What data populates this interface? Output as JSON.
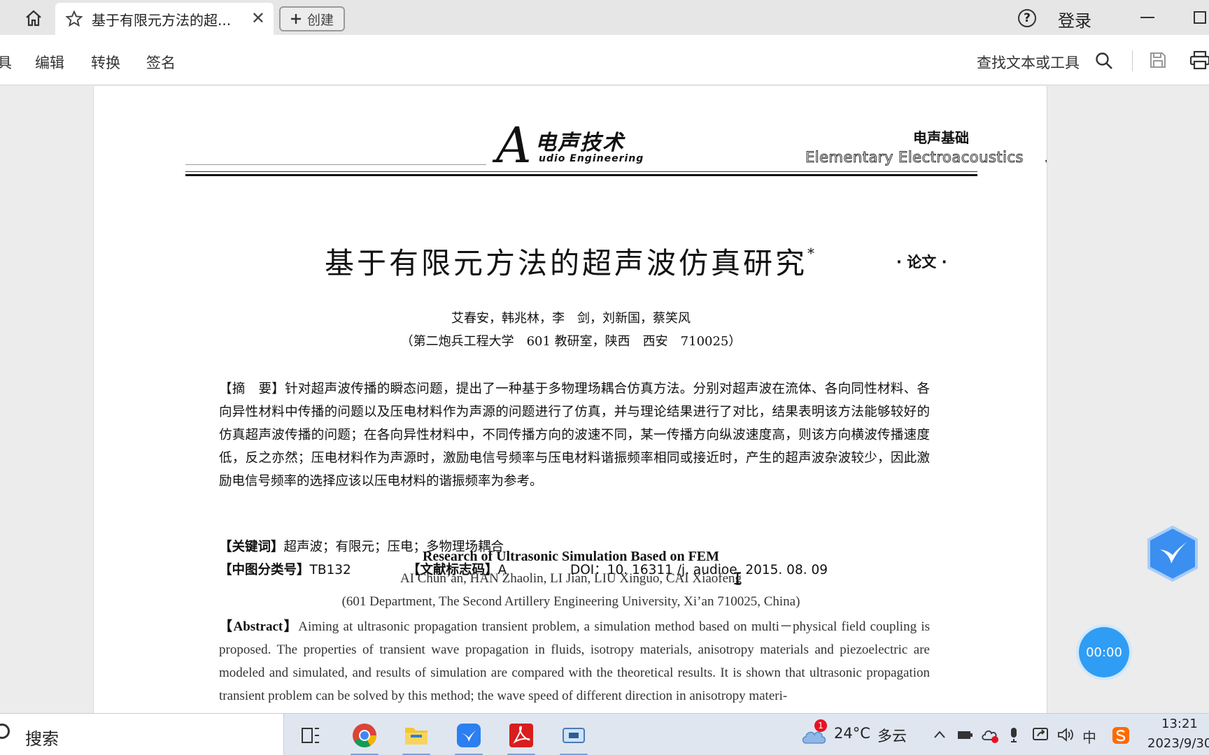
{
  "tabbar": {
    "tab_title": "基于有限元方法的超...",
    "close_glyph": "✕",
    "create_label": "创建",
    "help_glyph": "?",
    "login_label": "登录"
  },
  "toolbar": {
    "menu": [
      "具",
      "编辑",
      "转换",
      "签名"
    ],
    "find_label": "查找文本或工具"
  },
  "document": {
    "journal_logo_letter": "A",
    "journal_name_cn": "电声技术",
    "journal_name_en": "udio Engineering",
    "section_cn": "电声基础",
    "section_en": "Elementary Electroacoustics",
    "title_cn": "基于有限元方法的超声波仿真研究",
    "title_mark": "*",
    "paper_type": "· 论文 ·",
    "authors_cn": "艾春安，韩兆林，李　剑，刘新国，蔡笑风",
    "affiliation_cn": "（第二炮兵工程大学　601 教研室，陕西　西安　710025）",
    "abstract_cn": "【摘　要】针对超声波传播的瞬态问题，提出了一种基于多物理场耦合仿真方法。分别对超声波在流体、各向同性材料、各向异性材料中传播的问题以及压电材料作为声源的问题进行了仿真，并与理论结果进行了对比，结果表明该方法能够较好的仿真超声波传播的问题；在各向异性材料中，不同传播方向的波速不同，某一传播方向纵波速度高，则该方向横波传播速度低，反之亦然；压电材料作为声源时，激励电信号频率与压电材料谐振频率相同或接近时，产生的超声波杂波较少，因此激励电信号频率的选择应该以压电材料的谐振频率为参考。",
    "keywords_label": "【关键词】",
    "keywords": "超声波；有限元；压电；多物理场耦合",
    "clc_label": "【中图分类号】",
    "clc": "TB132",
    "doc_code_label": "【文献标志码】",
    "doc_code": "A",
    "doi": "DOI：10. 16311 /j. audioe. 2015. 08. 09",
    "title_en": "Research of Ultrasonic Simulation Based on FEM",
    "authors_en": "AI Chun’an, HAN Zhaolin, LI Jian, LIU Xinguo, CAI Xiaofeng",
    "affiliation_en": "(601 Department, The Second Artillery Engineering University, Xi’an 710025, China)",
    "abstract_en_label": "【Abstract】",
    "abstract_en": "Aiming at ultrasonic propagation transient problem, a simulation method based on multi－physical field coupling is proposed. The properties of transient wave propagation in fluids, isotropy materials, anisotropy materials and piezoelectric are modeled and simulated, and results of simulation are compared with the theoretical results. It is shown that ultrasonic propagation transient problem can be solved by this method; the wave speed of different direction in anisotropy materi-"
  },
  "widgets": {
    "timer": "00:00"
  },
  "taskbar": {
    "search_label": "搜索",
    "weather_temp": "24°C",
    "weather_desc": "多云",
    "weather_badge": "1",
    "ime_label": "中",
    "clock_time": "13:21",
    "clock_date": "2023/9/30"
  },
  "colors": {
    "accent_blue": "#2f9df4",
    "adobe_red": "#d81e1e"
  }
}
